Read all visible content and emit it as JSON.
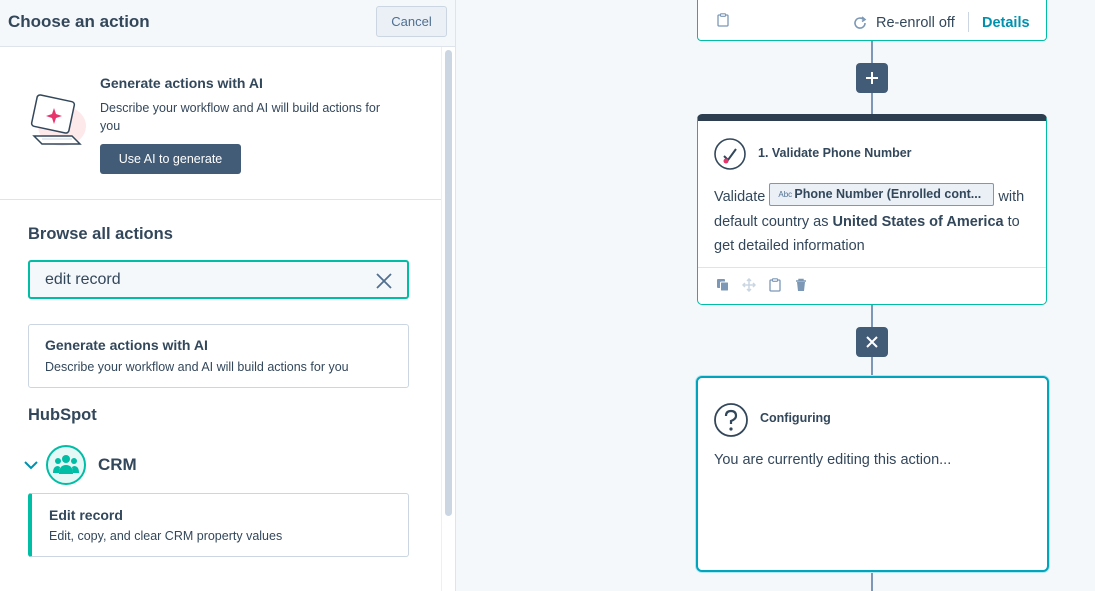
{
  "panel": {
    "title": "Choose an action",
    "cancel_label": "Cancel"
  },
  "ai_promo": {
    "title": "Generate actions with AI",
    "description": "Describe your workflow and AI will build actions for you",
    "button_label": "Use AI to generate"
  },
  "browse": {
    "title": "Browse all actions",
    "search_value": "edit record"
  },
  "results": {
    "ai_card": {
      "title": "Generate actions with AI",
      "description": "Describe your workflow and AI will build actions for you"
    },
    "group_label": "HubSpot",
    "category_label": "CRM",
    "items": [
      {
        "title": "Edit record",
        "description": "Edit, copy, and clear CRM property values"
      }
    ]
  },
  "canvas": {
    "enrollment_card": {
      "reenroll_label": "Re-enroll off",
      "details_label": "Details"
    },
    "validate_action": {
      "title": "1. Validate Phone Number",
      "text_validate": "Validate",
      "token_icon": "Abc",
      "token_label": "Phone Number (Enrolled cont...",
      "text_with": "with",
      "text_default_country": "default country as",
      "country": "United States of America",
      "text_end": "to get detailed information"
    },
    "configuring_action": {
      "title": "Configuring",
      "body": "You are currently editing this action..."
    }
  },
  "colors": {
    "accent_teal": "#00bda5",
    "primary_dark": "#425b76",
    "link": "#0091ae",
    "text": "#33475b"
  }
}
